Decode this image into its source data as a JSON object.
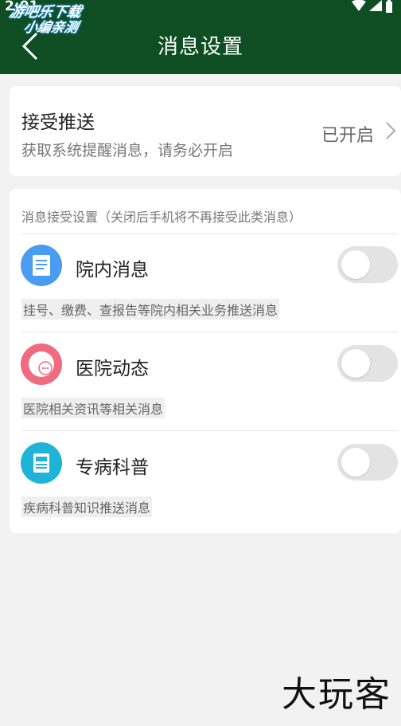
{
  "status_bar": {
    "time": "2:01"
  },
  "watermark": {
    "line1": "游吧乐下载",
    "line2": "小编亲测"
  },
  "app_bar": {
    "title": "消息设置"
  },
  "push": {
    "title": "接受推送",
    "subtitle": "获取系统提醒消息，请务必开启",
    "status": "已开启"
  },
  "settings": {
    "header": "消息接受设置（关闭后手机将不再接受此类消息）",
    "items": [
      {
        "label": "院内消息",
        "description": "挂号、缴费、查报告等院内相关业务推送消息",
        "enabled": false,
        "icon": "document-icon",
        "color": "#4a9cf0"
      },
      {
        "label": "医院动态",
        "description": "医院相关资讯等相关消息",
        "enabled": false,
        "icon": "chat-bubble-icon",
        "color": "#f06b7f"
      },
      {
        "label": "专病科普",
        "description": "疾病科普知识推送消息",
        "enabled": false,
        "icon": "article-icon",
        "color": "#1fb3d8"
      }
    ]
  },
  "footer_logo": "大玩客"
}
